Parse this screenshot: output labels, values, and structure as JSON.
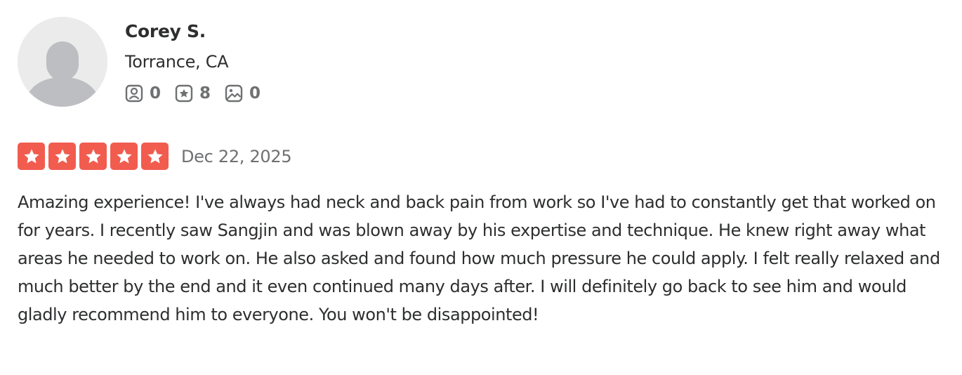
{
  "user": {
    "name": "Corey S.",
    "location": "Torrance, CA",
    "stats": [
      {
        "icon": "friends-icon",
        "count": "0"
      },
      {
        "icon": "reviews-star-icon",
        "count": "8"
      },
      {
        "icon": "photos-icon",
        "count": "0"
      }
    ]
  },
  "review": {
    "rating": 5,
    "date": "Dec 22, 2025",
    "text": "Amazing experience! I've always had neck and back pain from work so I've had to constantly get that worked on for years. I recently saw Sangjin and was blown away by his expertise and technique. He knew right away what areas he needed to work on. He also asked and found how much pressure he could apply. I felt really relaxed and much better by the end and it even continued many days after. I will definitely go back to see him and would gladly recommend him to everyone. You won't be disappointed!"
  },
  "colors": {
    "star_fill": "#f15c4f",
    "text": "#2d2e2f",
    "muted": "#6e7072",
    "avatar_bg": "#ebebeb",
    "avatar_fg": "#bdbec1"
  }
}
